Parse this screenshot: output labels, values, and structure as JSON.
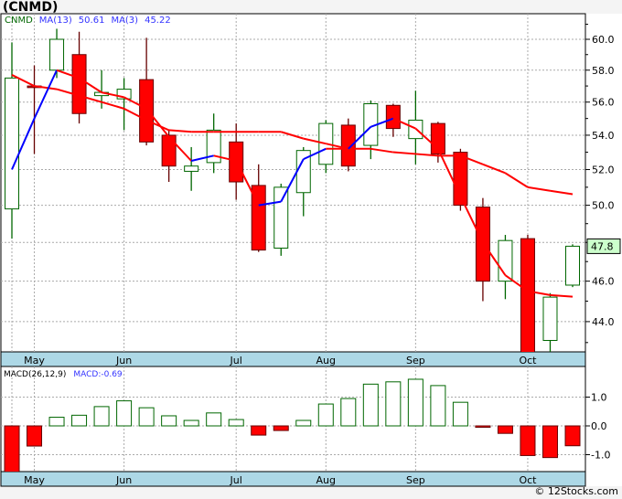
{
  "title": "(CNMD)",
  "footer": "© 12Stocks.com",
  "legend": {
    "symbol": "CNMD",
    "ma13_label": "MA(13)",
    "ma13_value": "50.61",
    "ma3_label": "MA(3)",
    "ma3_value": "45.22"
  },
  "macd_legend": {
    "label": "MACD(26,12,9)",
    "value": "MACD:-0.69"
  },
  "last_price_label": "47.8",
  "colors": {
    "up": "#006600",
    "down": "#ff0000",
    "ma_up": "#0000ff",
    "ma_down": "#ff0000",
    "axis_bar": "#add8e6",
    "price_tag": "#ccffcc"
  },
  "chart_data": [
    {
      "type": "candlestick",
      "title": "",
      "scale": "log",
      "ylim": [
        42.2,
        62.0
      ],
      "yticks": [
        "44.0",
        "46.0",
        "48.0",
        "50.0",
        "52.0",
        "54.0",
        "56.0",
        "58.0",
        "60.0"
      ],
      "month_labels": [
        {
          "label": "May",
          "index": 1
        },
        {
          "label": "Jun",
          "index": 5
        },
        {
          "label": "Jul",
          "index": 10
        },
        {
          "label": "Aug",
          "index": 14
        },
        {
          "label": "Sep",
          "index": 18
        },
        {
          "label": "Oct",
          "index": 23
        }
      ],
      "ohlc": [
        [
          49.8,
          59.8,
          48.2,
          57.5
        ],
        [
          57.0,
          58.3,
          52.9,
          56.9
        ],
        [
          58.0,
          60.7,
          57.5,
          60.0
        ],
        [
          59.0,
          60.5,
          54.7,
          55.3
        ],
        [
          56.4,
          58.0,
          55.6,
          56.6
        ],
        [
          56.2,
          57.5,
          54.3,
          56.8
        ],
        [
          57.4,
          60.1,
          53.4,
          53.6
        ],
        [
          54.0,
          54.3,
          51.3,
          52.2
        ],
        [
          51.9,
          53.3,
          50.8,
          52.2
        ],
        [
          52.4,
          55.3,
          51.8,
          54.3
        ],
        [
          53.6,
          54.7,
          50.3,
          51.3
        ],
        [
          51.1,
          52.3,
          47.5,
          47.6
        ],
        [
          47.7,
          51.2,
          47.3,
          51.0
        ],
        [
          50.7,
          53.3,
          49.4,
          53.1
        ],
        [
          52.3,
          54.9,
          51.8,
          54.7
        ],
        [
          54.6,
          55.0,
          51.9,
          52.2
        ],
        [
          53.4,
          56.1,
          52.6,
          55.9
        ],
        [
          55.8,
          55.9,
          53.9,
          54.4
        ],
        [
          53.8,
          56.7,
          52.3,
          54.9
        ],
        [
          54.7,
          54.8,
          52.4,
          52.9
        ],
        [
          53.0,
          53.2,
          49.7,
          50.0
        ],
        [
          49.9,
          50.4,
          45.0,
          46.0
        ],
        [
          46.0,
          48.4,
          45.1,
          48.1
        ],
        [
          48.2,
          48.4,
          42.3,
          42.5
        ],
        [
          43.1,
          45.4,
          42.3,
          45.2
        ],
        [
          45.8,
          47.9,
          45.7,
          47.8
        ]
      ],
      "ma13": [
        57.7,
        57.0,
        56.8,
        56.4,
        56.0,
        55.6,
        54.9,
        54.3,
        54.2,
        54.2,
        54.2,
        54.2,
        54.2,
        53.8,
        53.5,
        53.2,
        53.2,
        53.0,
        52.9,
        52.8,
        52.8,
        52.3,
        51.8,
        51.0,
        50.8,
        50.61
      ],
      "ma3": [
        52.0,
        55.0,
        58.0,
        57.5,
        56.6,
        56.3,
        55.6,
        53.9,
        52.5,
        52.8,
        52.5,
        50.0,
        50.2,
        52.6,
        53.2,
        53.2,
        54.5,
        55.0,
        54.4,
        53.2,
        50.5,
        48.0,
        46.3,
        45.5,
        45.3,
        45.22
      ]
    },
    {
      "type": "bar",
      "title": "",
      "ylim": [
        -1.6,
        2.0
      ],
      "yticks": [
        "1.0",
        "0.0",
        "-1.0"
      ],
      "values": [
        -1.6,
        -0.7,
        0.3,
        0.37,
        0.67,
        0.87,
        0.63,
        0.35,
        0.19,
        0.45,
        0.22,
        -0.32,
        -0.16,
        0.19,
        0.76,
        0.95,
        1.45,
        1.53,
        1.62,
        1.4,
        0.82,
        -0.03,
        -0.26,
        -1.03,
        -1.1,
        -0.69
      ]
    }
  ]
}
